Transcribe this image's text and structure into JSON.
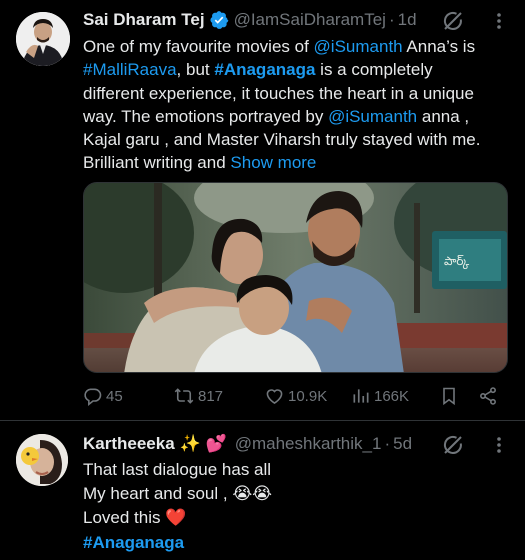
{
  "tweet1": {
    "author_name": "Sai Dharam Tej",
    "handle": "@IamSaiDharamTej",
    "time": "1d",
    "text_lines": [
      {
        "parts": [
          {
            "t": "One of my favourite movies of ",
            "k": "text"
          },
          {
            "t": "@iSumanth",
            "k": "link"
          },
          {
            "t": " Anna’s is",
            "k": "text"
          }
        ]
      },
      {
        "parts": [
          {
            "t": "#MalliRaava",
            "k": "link"
          },
          {
            "t": ", but ",
            "k": "text"
          },
          {
            "t": "#Anaganaga",
            "k": "linkbold"
          },
          {
            "t": " is a completely",
            "k": "text"
          }
        ]
      },
      {
        "parts": [
          {
            "t": "different experience, it touches the heart in a unique",
            "k": "text"
          }
        ]
      },
      {
        "parts": [
          {
            "t": "way. The emotions portrayed by ",
            "k": "text"
          },
          {
            "t": "@iSumanth",
            "k": "link"
          },
          {
            "t": "  anna ,",
            "k": "text"
          }
        ]
      },
      {
        "parts": [
          {
            "t": "Kajal garu , and Master Viharsh truly stayed with me.",
            "k": "text"
          }
        ]
      },
      {
        "parts": [
          {
            "t": "Brilliant writing and ",
            "k": "text"
          },
          {
            "t": "Show more",
            "k": "link"
          }
        ]
      }
    ],
    "stats": {
      "replies": "45",
      "reposts": "817",
      "likes": "10.9K",
      "views": "166K"
    },
    "media_sign_text": "పార్క్"
  },
  "tweet2": {
    "author_name": "Kartheeeka",
    "name_emojis": "✨ 💕",
    "handle": "@maheshkarthik_1",
    "time": "5d",
    "line1": "That last dialogue has all",
    "line2": "My heart and soul ,",
    "line2_emoji": "😭😭",
    "line3": "Loved this",
    "line3_emoji": "❤️",
    "hashtag": "#Anaganaga"
  },
  "colors": {
    "background": "#000000",
    "text": "#e7e9ea",
    "muted": "#71767b",
    "link": "#1d9bf0",
    "divider": "#2f3336"
  }
}
